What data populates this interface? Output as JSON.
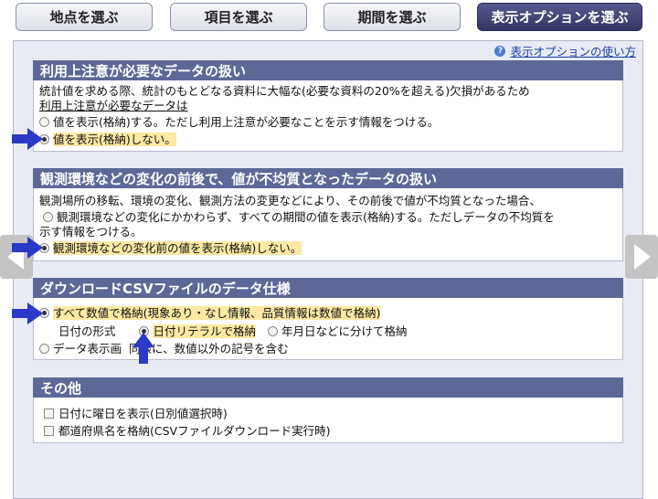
{
  "tabs": [
    {
      "label": "地点を選ぶ"
    },
    {
      "label": "項目を選ぶ"
    },
    {
      "label": "期間を選ぶ"
    },
    {
      "label": "表示オプションを選ぶ"
    }
  ],
  "help_link": "表示オプションの使い方",
  "sections": {
    "caution": {
      "title": "利用上注意が必要なデータの扱い",
      "desc1": "統計値を求める際、統計のもとどなる資料に大幅な(必要な資料の20%を超える)欠損があるため",
      "desc2": "利用上注意が必要なデータは",
      "opt1": "値を表示(格納)する。ただし利用上注意が必要なことを示す情報をつける。",
      "opt2": "値を表示(格納)しない。"
    },
    "env": {
      "title": "観測環境などの変化の前後で、値が不均質となったデータの扱い",
      "desc": "観測場所の移転、環境の変化、観測方法の変更などにより、その前後で値が不均質となった場合、",
      "opt1a": "観測環境などの変化にかかわらず、すべての期間の値を表示(格納)する。ただしデータの不均質を",
      "opt1b": "示す情報をつける。",
      "opt2": "観測環境などの変化前の値を表示(格納)しない。"
    },
    "csv": {
      "title": "ダウンロードCSVファイルのデータ仕様",
      "opt1": "すべて数値で格納(現象あり・なし情報、品質情報は数値で格納)",
      "date_label": "日付の形式",
      "date_opt1": "日付リテラルで格納",
      "date_opt2": "年月日などに分けて格納",
      "opt2_a": "データ表示画",
      "opt2_b": "同様に、数値以外の記号を含む"
    },
    "other": {
      "title": "その他",
      "chk1": "日付に曜日を表示(日別値選択時)",
      "chk2": "都道府県名を格納(CSVファイルダウンロード実行時)"
    }
  },
  "colors": {
    "section_header": "#5e6898",
    "active_tab": "#3e4170",
    "highlight": "#fde9a4",
    "arrow": "#2b39c7"
  }
}
